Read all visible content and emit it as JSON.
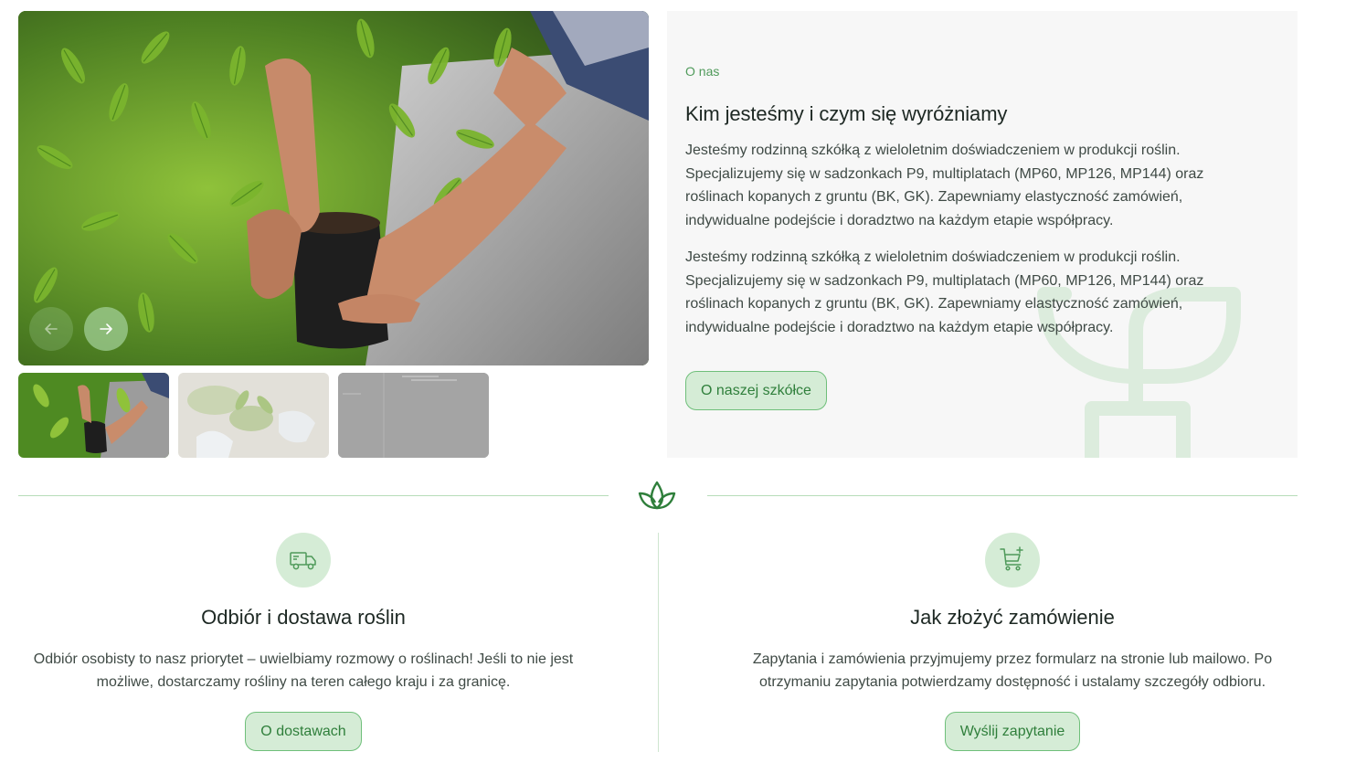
{
  "gallery": {
    "main_alt": "photo-hands-planting",
    "thumbnails": [
      "thumb-planting",
      "thumb-gloves",
      "thumb-placeholder"
    ]
  },
  "about": {
    "eyebrow": "O nas",
    "title": "Kim jesteśmy i czym się wyróżniamy",
    "paragraphs": [
      "Jesteśmy rodzinną szkółką z wieloletnim doświadczeniem w produkcji roślin. Specjalizujemy się w sadzonkach P9, multiplatach (MP60, MP126, MP144) oraz roślinach kopanych z gruntu (BK, GK). Zapewniamy elastyczność zamówień, indywidualne podejście i doradztwo na każdym etapie współpracy.",
      "Jesteśmy rodzinną szkółką z wieloletnim doświadczeniem w produkcji roślin. Specjalizujemy się w sadzonkach P9, multiplatach (MP60, MP126, MP144) oraz roślinach kopanych z gruntu (BK, GK). Zapewniamy elastyczność zamówień, indywidualne podejście i doradztwo na każdym etapie współpracy."
    ],
    "button": "O naszej szkółce"
  },
  "features": [
    {
      "icon": "truck-icon",
      "title": "Odbiór i dostawa roślin",
      "text": "Odbiór osobisty to nasz priorytet – uwielbiamy rozmowy o roślinach! Jeśli to nie jest możliwe, dostarczamy rośliny na teren całego kraju i za granicę.",
      "button": "O dostawach"
    },
    {
      "icon": "cart-plus-icon",
      "title": "Jak złożyć zamówienie",
      "text": "Zapytania i zamówienia przyjmujemy przez formularz na stronie lub mailowo. Po otrzymaniu zapytania potwierdzamy dostępność i ustalamy szczegóły odbioru.",
      "button": "Wyślij zapytanie"
    }
  ],
  "colors": {
    "accent": "#4f9a5a",
    "button_bg": "#d5ecd6",
    "button_border": "#6fbf7a",
    "card_bg": "#f7f7f7"
  }
}
